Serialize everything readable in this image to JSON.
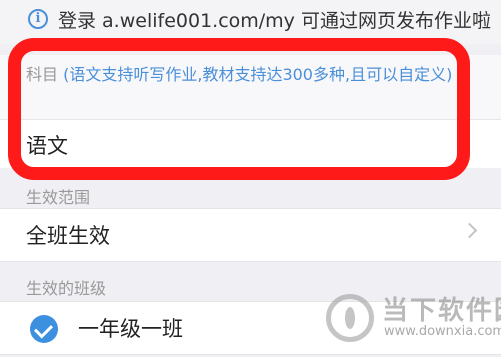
{
  "notice": {
    "text": "登录 a.welife001.com/my 可通过网页发布作业啦"
  },
  "subject": {
    "label": "科目",
    "hint": "(语文支持听写作业,教材支持达300多种,且可以自定义)",
    "value": "语文"
  },
  "scope": {
    "label": "生效范围",
    "value": "全班生效"
  },
  "classes": {
    "label": "生效的班级",
    "items": [
      {
        "name": "一年级一班",
        "checked": true
      }
    ]
  },
  "watermark": {
    "title": "当下软件园",
    "url": "www.downxia.com"
  },
  "colors": {
    "accent": "#3d8fe0",
    "highlight": "#ff1a1a"
  }
}
